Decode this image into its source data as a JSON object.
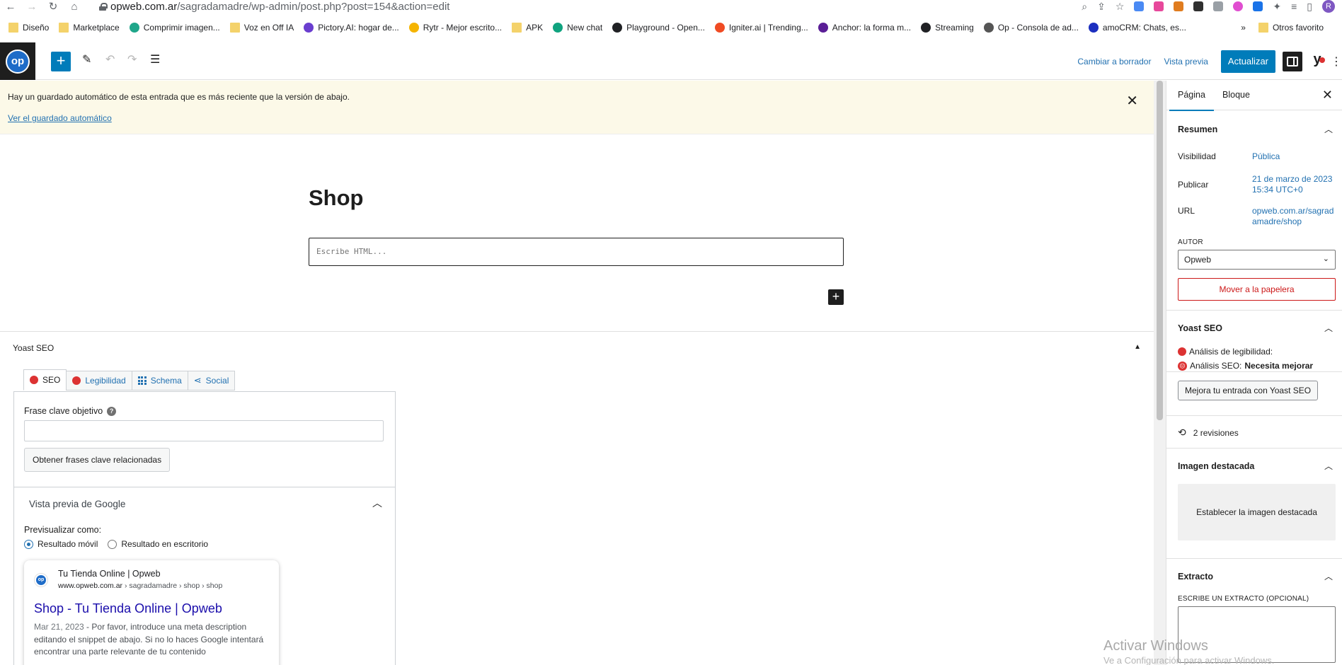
{
  "browser": {
    "url_host": "opweb.com.ar",
    "url_path": "/sagradamadre/wp-admin/post.php?post=154&action=edit",
    "avatar_letter": "R",
    "bookmarks": [
      {
        "label": "Diseño",
        "icon": "folder-icon",
        "color": "#f4d26b"
      },
      {
        "label": "Marketplace",
        "icon": "folder-icon",
        "color": "#f4d26b"
      },
      {
        "label": "Comprimir imagen...",
        "icon": "compress-icon",
        "color": "#1fa68a"
      },
      {
        "label": "Voz en Off IA",
        "icon": "folder-icon",
        "color": "#f4d26b"
      },
      {
        "label": "Pictory.AI: hogar de...",
        "icon": "pictory-icon",
        "color": "#6a3ecf"
      },
      {
        "label": "Rytr - Mejor escrito...",
        "icon": "rytr-icon",
        "color": "#f5b400"
      },
      {
        "label": "APK",
        "icon": "folder-icon",
        "color": "#f4d26b"
      },
      {
        "label": "New chat",
        "icon": "openai-icon",
        "color": "#10a37f"
      },
      {
        "label": "Playground - Open...",
        "icon": "openai-icon",
        "color": "#202124"
      },
      {
        "label": "Igniter.ai | Trending...",
        "icon": "igniter-icon",
        "color": "#f04b23"
      },
      {
        "label": "Anchor: la forma m...",
        "icon": "anchor-icon",
        "color": "#5a1e96"
      },
      {
        "label": "Streaming",
        "icon": "streaming-icon",
        "color": "#202124"
      },
      {
        "label": "Op - Consola de ad...",
        "icon": "op-icon",
        "color": "#555555"
      },
      {
        "label": "amoCRM: Chats, es...",
        "icon": "amocrm-icon",
        "color": "#1c2fbf"
      }
    ],
    "bookmarks_more": "»",
    "other_bookmarks": "Otros favorito"
  },
  "toolbar": {
    "logo_text": "op",
    "add_label": "+",
    "switch_to_draft": "Cambiar a borrador",
    "preview": "Vista previa",
    "update": "Actualizar",
    "yoast_letter": "y",
    "kebab": "⋮"
  },
  "notice": {
    "message": "Hay un guardado automático de esta entrada que es más reciente que la versión de abajo.",
    "link": "Ver el guardado automático",
    "close": "✕"
  },
  "editor": {
    "title": "Shop",
    "html_placeholder": "Escribe HTML...",
    "inserter": "+"
  },
  "yoast_metabox": {
    "heading": "Yoast SEO",
    "toggle": "▲",
    "tabs": [
      {
        "label": "SEO",
        "icon": "red-dot-icon",
        "active": true
      },
      {
        "label": "Legibilidad",
        "icon": "red-dot-icon",
        "active": false
      },
      {
        "label": "Schema",
        "icon": "grid-icon",
        "active": false
      },
      {
        "label": "Social",
        "icon": "share-icon",
        "active": false
      }
    ],
    "focus_keyphrase_label": "Frase clave objetivo",
    "help": "?",
    "focus_keyphrase_value": "",
    "related_button": "Obtener frases clave relacionadas",
    "google_preview_heading": "Vista previa de Google",
    "preview_as_label": "Previsualizar como:",
    "radio_mobile": "Resultado móvil",
    "radio_desktop": "Resultado en escritorio",
    "serp": {
      "site_name": "Tu Tienda Online | Opweb",
      "host": "www.opweb.com.ar",
      "crumb": " › sagradamadre › shop › shop",
      "title": "Shop - Tu Tienda Online | Opweb",
      "date": "Mar 21, 2023",
      "separator": " - ",
      "description": "Por favor, introduce una meta description editando el snippet de abajo. Si no lo haces Google intentará encontrar una parte relevante de tu contenido"
    }
  },
  "sidebar": {
    "tab_page": "Página",
    "tab_block": "Bloque",
    "close": "✕",
    "summary": {
      "heading": "Resumen",
      "visibility_label": "Visibilidad",
      "visibility_value": "Pública",
      "publish_label": "Publicar",
      "publish_value_line1": "21 de marzo de 2023",
      "publish_value_line2": "15:34 UTC+0",
      "url_label": "URL",
      "url_value_line1": "opweb.com.ar/sagrad",
      "url_value_line2": "amadre/shop",
      "author_caption": "AUTOR",
      "author_value": "Opweb",
      "trash": "Mover a la papelera"
    },
    "yoast": {
      "heading": "Yoast SEO",
      "readability": "Análisis de legibilidad:",
      "seo_prefix": "Análisis SEO:",
      "seo_value": "Necesita mejorar",
      "button": "Mejora tu entrada con Yoast SEO"
    },
    "revisions": "2 revisiones",
    "featured": {
      "heading": "Imagen destacada",
      "button": "Establecer la imagen destacada"
    },
    "excerpt": {
      "heading": "Extracto",
      "caption": "ESCRIBE UN EXTRACTO (OPCIONAL)"
    }
  },
  "watermark": {
    "line1": "Activar Windows",
    "line2": "Ve a Configuración para activar Windows."
  }
}
